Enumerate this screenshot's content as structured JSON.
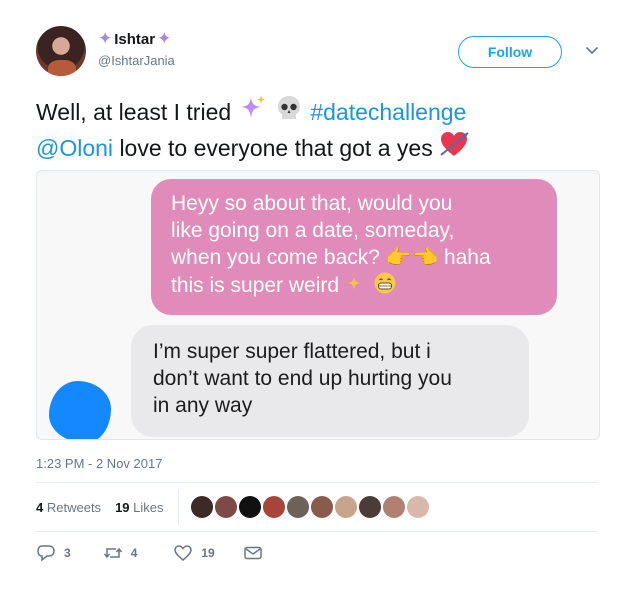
{
  "user": {
    "display_name": "Ishtar",
    "handle": "@IshtarJania",
    "follow_label": "Follow"
  },
  "tweet": {
    "line1_text": "Well, at least I tried ",
    "hashtag": "#datechallenge",
    "mention": "@Oloni",
    "line2_text": " love to everyone that got a yes "
  },
  "media": {
    "outgoing_message_line1": "Heyy so about that, would you",
    "outgoing_message_line2": "like going on a date, someday,",
    "outgoing_message_line3": "when you come back? ",
    "outgoing_message_line3_end": " haha",
    "outgoing_message_line4": "this is super weird ",
    "incoming_message_line1": "I’m super super flattered, but i",
    "incoming_message_line2": "don’t want to end up hurting you",
    "incoming_message_line3": "in any way"
  },
  "timestamp": "1:23 PM - 2 Nov 2017",
  "stats": {
    "retweets_count": "4",
    "retweets_label": "Retweets",
    "likes_count": "19",
    "likes_label": "Likes"
  },
  "actions": {
    "reply_count": "3",
    "retweet_count": "4",
    "like_count": "19"
  },
  "icons": {
    "sparkle": "sparkles-icon",
    "skull": "skull-icon",
    "heart_arrow": "heart-with-arrow-icon",
    "reply": "reply-icon",
    "retweet": "retweet-icon",
    "like": "heart-icon",
    "message": "envelope-icon"
  },
  "colors": {
    "link": "#1b95e0",
    "follow_border": "#1da1f2",
    "outgoing_bubble": "#e08bb9",
    "incoming_bubble": "#e9e9eb",
    "redaction": "#1388ff",
    "muted": "#657786"
  }
}
